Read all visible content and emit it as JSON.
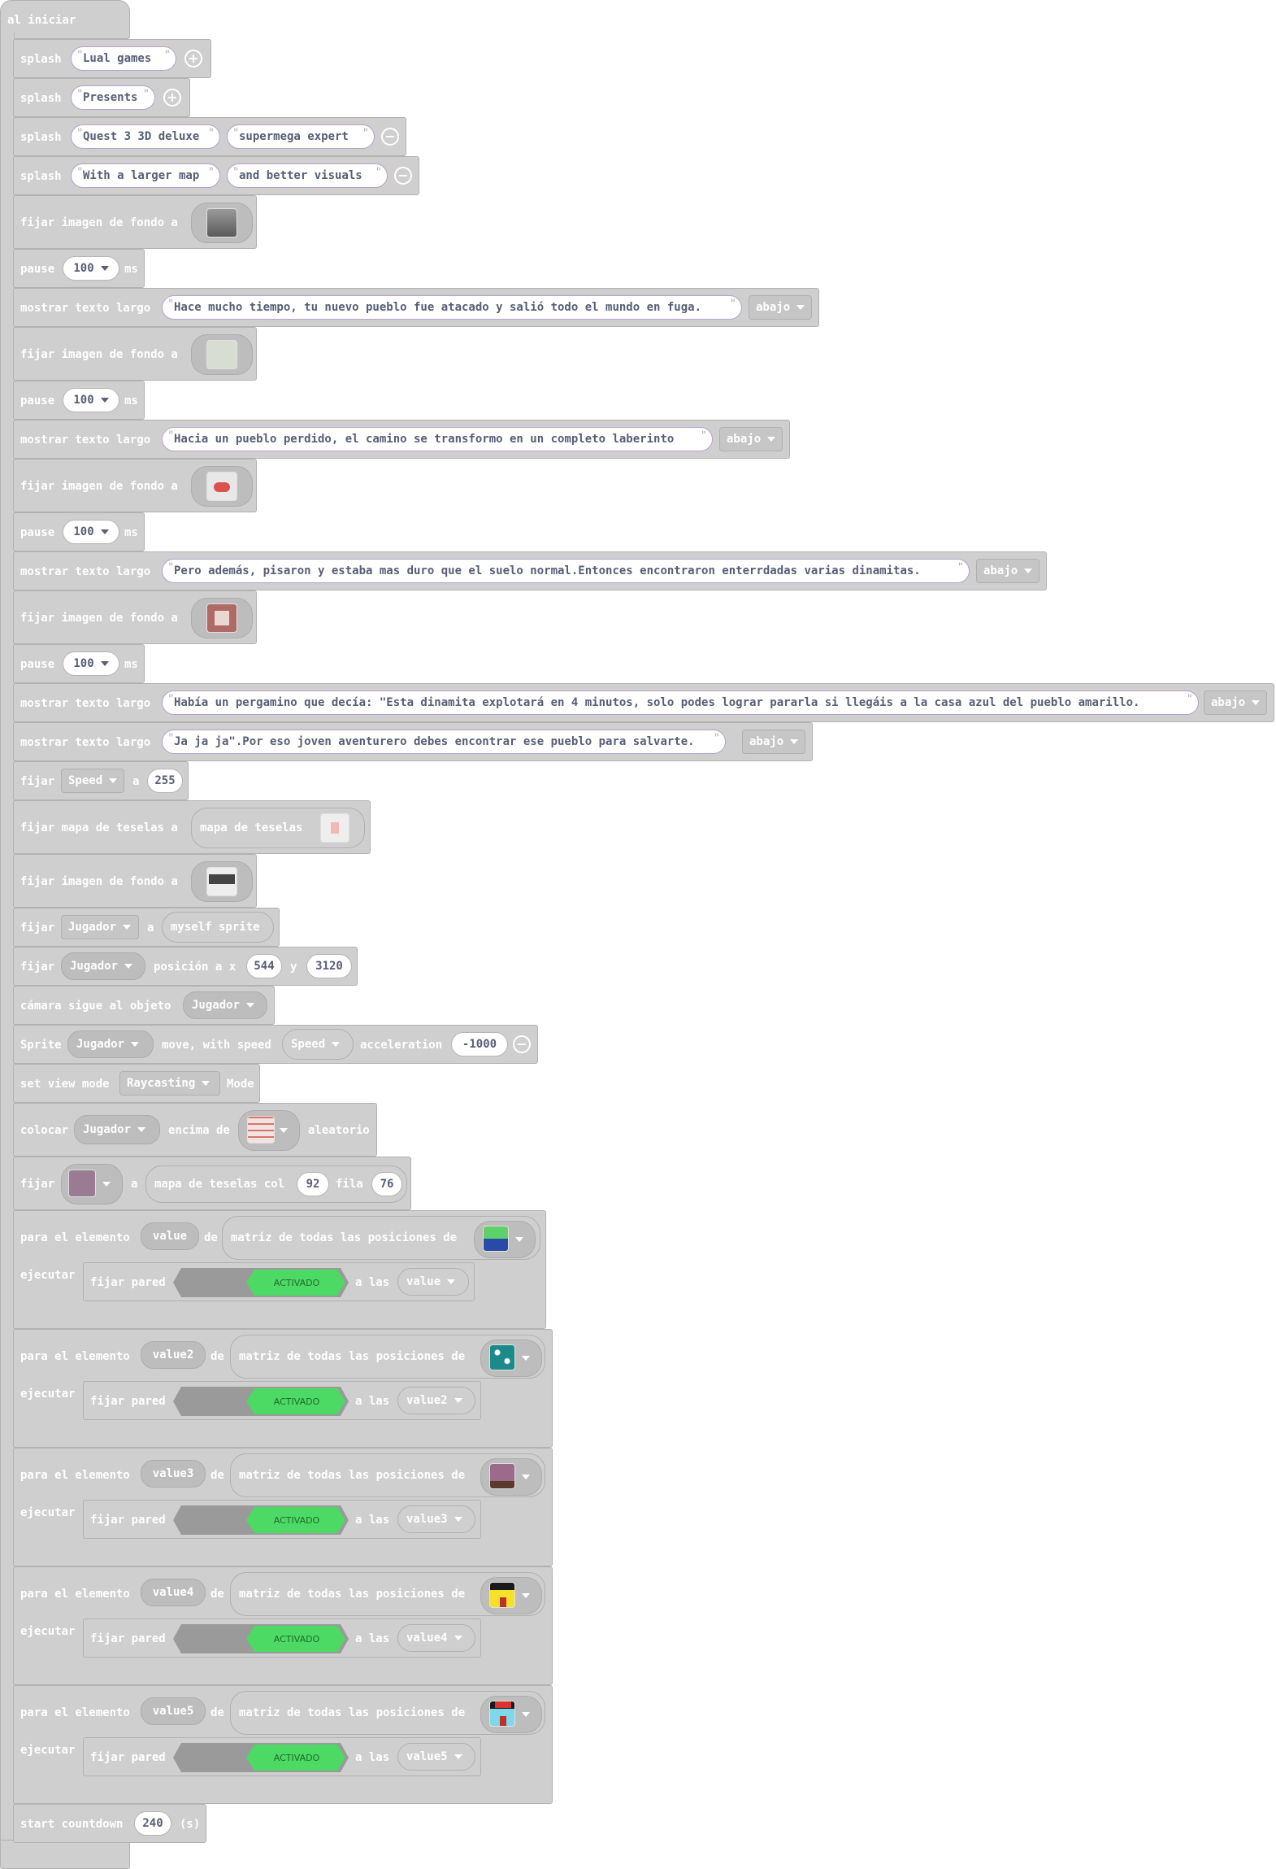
{
  "hat": {
    "label": "al iniciar"
  },
  "labels": {
    "splash": "splash",
    "set_background": "fijar imagen de fondo a",
    "pause": "pause",
    "ms": "ms",
    "long_text": "mostrar texto largo",
    "set": "fijar",
    "to": "a",
    "set_tilemap": "fijar mapa de teselas a",
    "tilemap": "mapa de teselas",
    "position": "posición a x",
    "y": "y",
    "camera": "cámara sigue al objeto",
    "sprite": "Sprite",
    "move_speed": "move, with speed",
    "acceleration": "acceleration",
    "view_mode": "set view mode",
    "mode": "Mode",
    "place": "colocar",
    "on_top": "encima de",
    "random": "aleatorio",
    "tilemap_col": "mapa de teselas col",
    "row": "fila",
    "for_element": "para el elemento",
    "of": "de",
    "array_all": "matriz de todas las posiciones de",
    "execute": "ejecutar",
    "set_wall": "fijar pared",
    "at": "a las",
    "activated": "ACTIVADO",
    "countdown": "start countdown",
    "seconds": "(s)"
  },
  "splash": [
    {
      "a": "Lual games"
    },
    {
      "a": "Presents"
    },
    {
      "a": "Quest 3 3D deluxe",
      "b": "supermega expert"
    },
    {
      "a": "With a larger map",
      "b": "and better visuals"
    }
  ],
  "pause_values": [
    "100",
    "100",
    "100",
    "100"
  ],
  "long_texts": [
    "Hace mucho tiempo, tu nuevo pueblo fue atacado y salió todo el mundo en fuga.",
    "Hacia un pueblo perdido, el camino se transformo en un completo laberinto",
    "Pero además, pisaron y estaba mas duro que el suelo normal.Entonces encontraron enterrdadas varias dinamitas.",
    "Había un pergamino que decía: \"Esta dinamita explotará en 4 minutos, solo podes lograr pararla si llegáis a la casa azul del pueblo amarillo.",
    "Ja ja ja\".Por eso joven aventurero debes encontrar ese pueblo para salvarte."
  ],
  "text_position": "abajo",
  "speed_var": "Speed",
  "speed_value": "255",
  "player_var": "Jugador",
  "myself_sprite": "myself sprite",
  "pos_x": "544",
  "pos_y": "3120",
  "acceleration_value": "-1000",
  "view_mode_value": "Raycasting",
  "tile_col": "92",
  "tile_row": "76",
  "loops": [
    {
      "var": "value"
    },
    {
      "var": "value2"
    },
    {
      "var": "value3"
    },
    {
      "var": "value4"
    },
    {
      "var": "value5"
    }
  ],
  "countdown_value": "240",
  "colors": {
    "block": "#cfcfcf",
    "toggle_on": "#4cd964",
    "string_border": "#b7a0c9"
  },
  "icons": [
    "add-circle-icon",
    "remove-circle-icon",
    "dropdown-caret-icon",
    "background-image-thumbnail",
    "tile-thumbnail"
  ]
}
